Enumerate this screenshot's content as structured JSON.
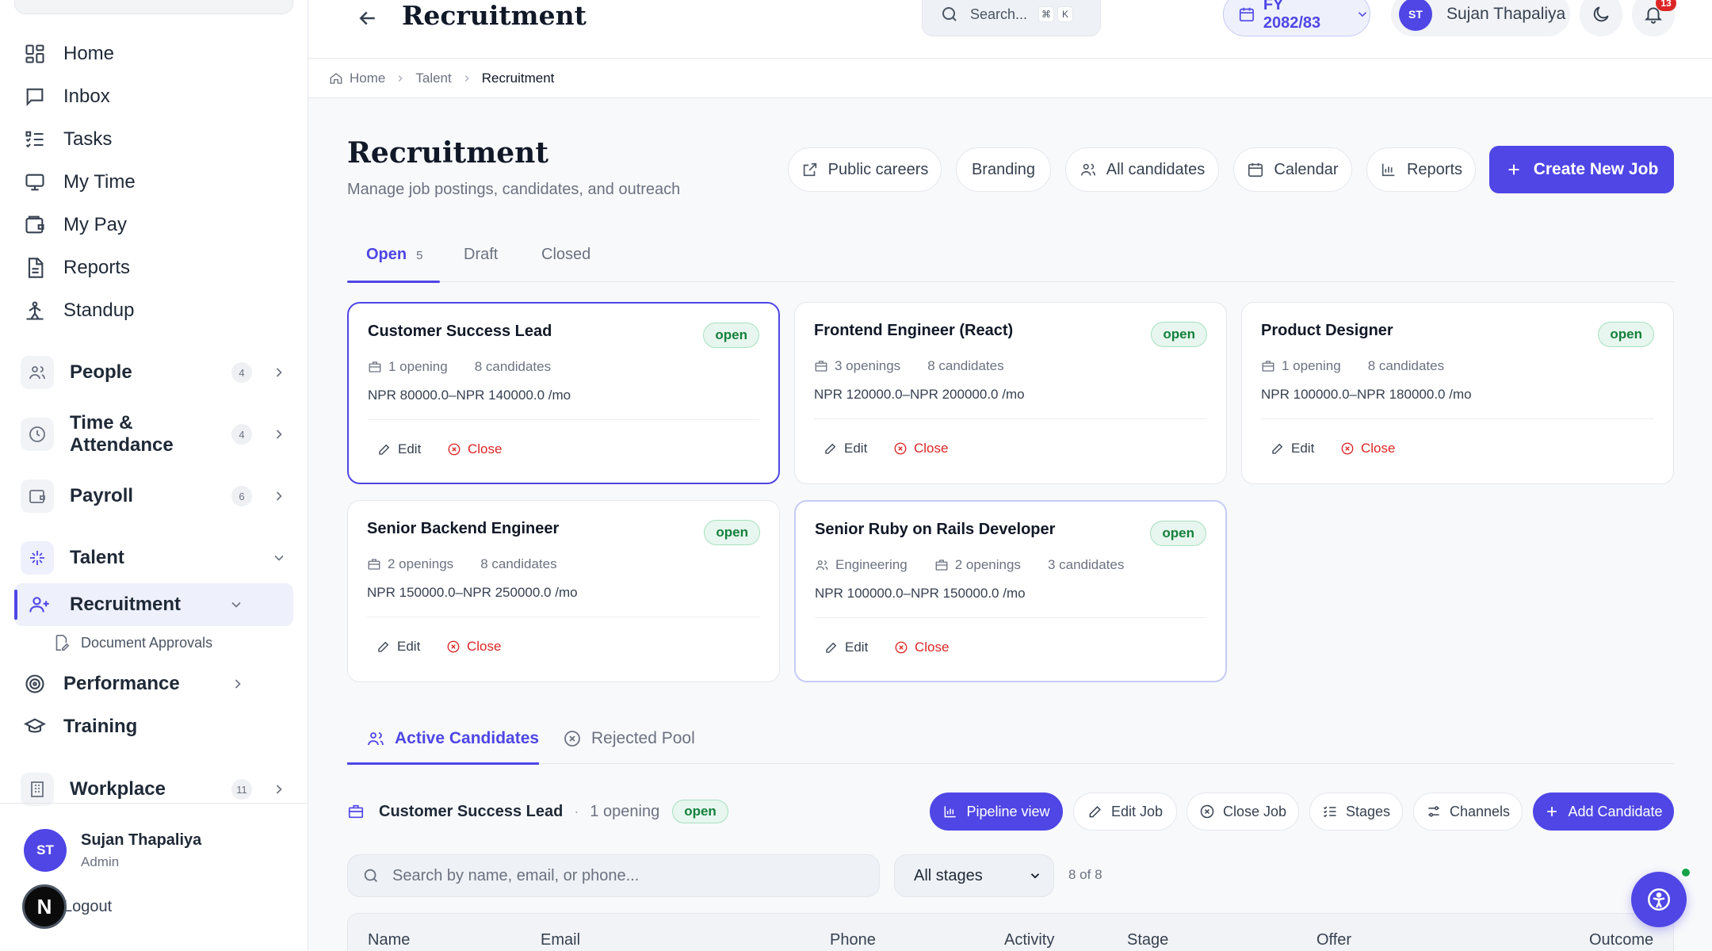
{
  "sidebar": {
    "nav": [
      {
        "label": "Home",
        "icon": "grid-icon"
      },
      {
        "label": "Inbox",
        "icon": "message-icon"
      },
      {
        "label": "Tasks",
        "icon": "list-check-icon"
      },
      {
        "label": "My Time",
        "icon": "monitor-icon"
      },
      {
        "label": "My Pay",
        "icon": "wallet-icon"
      },
      {
        "label": "Reports",
        "icon": "file-text-icon"
      },
      {
        "label": "Standup",
        "icon": "standup-icon"
      }
    ],
    "groups": {
      "people": {
        "label": "People",
        "badge": "4"
      },
      "time": {
        "label": "Time & Attendance",
        "badge": "4"
      },
      "payroll": {
        "label": "Payroll",
        "badge": "6"
      },
      "talent": {
        "label": "Talent"
      },
      "workplace": {
        "label": "Workplace",
        "badge": "11"
      }
    },
    "recruitment": "Recruitment",
    "document_approvals": "Document Approvals",
    "performance": "Performance",
    "training": "Training",
    "user": {
      "initials": "ST",
      "name": "Sujan Thapaliya",
      "role": "Admin"
    },
    "logout": "Logout",
    "next_badge": "N"
  },
  "topbar": {
    "title": "Recruitment",
    "search_placeholder": "Search...",
    "kbd1": "⌘",
    "kbd2": "K",
    "fiscal_year": "FY 2082/83",
    "user_initials": "ST",
    "user_name": "Sujan Thapaliya",
    "notification_count": "13"
  },
  "breadcrumb": [
    "Home",
    "Talent",
    "Recruitment"
  ],
  "page": {
    "title": "Recruitment",
    "subtitle": "Manage job postings, candidates, and outreach",
    "buttons": {
      "public_careers": "Public careers",
      "branding": "Branding",
      "all_candidates": "All candidates",
      "calendar": "Calendar",
      "reports": "Reports",
      "create_job": "Create New Job"
    }
  },
  "job_tabs": {
    "open": "Open",
    "open_count": "5",
    "draft": "Draft",
    "closed": "Closed"
  },
  "jobs": [
    {
      "title": "Customer Success Lead",
      "status": "open",
      "openings": "1 opening",
      "candidates": "8 candidates",
      "salary": "NPR 80000.0–NPR 140000.0 /mo",
      "edit": "Edit",
      "close": "Close"
    },
    {
      "title": "Frontend Engineer (React)",
      "status": "open",
      "openings": "3 openings",
      "candidates": "8 candidates",
      "salary": "NPR 120000.0–NPR 200000.0 /mo",
      "edit": "Edit",
      "close": "Close"
    },
    {
      "title": "Product Designer",
      "status": "open",
      "openings": "1 opening",
      "candidates": "8 candidates",
      "salary": "NPR 100000.0–NPR 180000.0 /mo",
      "edit": "Edit",
      "close": "Close"
    },
    {
      "title": "Senior Backend Engineer",
      "status": "open",
      "openings": "2 openings",
      "candidates": "8 candidates",
      "salary": "NPR 150000.0–NPR 250000.0 /mo",
      "edit": "Edit",
      "close": "Close"
    },
    {
      "title": "Senior Ruby on Rails Developer",
      "status": "open",
      "department": "Engineering",
      "openings": "2 openings",
      "candidates": "3 candidates",
      "salary": "NPR 100000.0–NPR 150000.0 /mo",
      "edit": "Edit",
      "close": "Close"
    }
  ],
  "candidate_tabs": {
    "active": "Active Candidates",
    "rejected": "Rejected Pool"
  },
  "selected_job": {
    "title": "Customer Success Lead",
    "separator": "·",
    "openings": "1 opening",
    "status": "open"
  },
  "toolbar": {
    "pipeline_view": "Pipeline view",
    "edit_job": "Edit Job",
    "close_job": "Close Job",
    "stages": "Stages",
    "channels": "Channels",
    "add_candidate": "Add Candidate"
  },
  "filters": {
    "search_placeholder": "Search by name, email, or phone...",
    "stage_selected": "All stages",
    "count": "8 of 8"
  },
  "table": {
    "columns": [
      "Name",
      "Email",
      "Phone",
      "Activity",
      "Stage",
      "Offer",
      "Outcome"
    ]
  },
  "colors": {
    "accent": "#4f46e5",
    "status_open_bg": "#e7f6ee",
    "status_open_text": "#15803d",
    "danger": "#dc2626"
  }
}
